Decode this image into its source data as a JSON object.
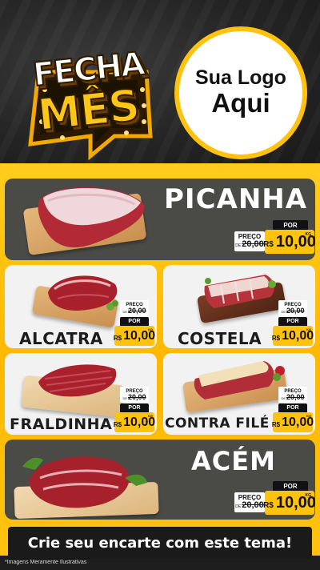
{
  "header": {
    "badge_line_1": "FECHA",
    "badge_line_2": "MÊS",
    "logo_line_1": "Sua Logo",
    "logo_line_2": "Aqui"
  },
  "price_tag": {
    "preco_label": "PREÇO",
    "old_prefix": "DE",
    "por_label": "POR",
    "currency": "R$",
    "unit": "KG"
  },
  "products": [
    {
      "name": "PICANHA",
      "old_price": "20,00",
      "new_price": "10,00"
    },
    {
      "name": "ALCATRA",
      "old_price": "20,00",
      "new_price": "10,00"
    },
    {
      "name": "COSTELA",
      "old_price": "20,00",
      "new_price": "10,00"
    },
    {
      "name": "FRALDINHA",
      "old_price": "20,00",
      "new_price": "10,00"
    },
    {
      "name": "CONTRA FILÉ",
      "old_price": "20,00",
      "new_price": "10,00"
    },
    {
      "name": "ACÉM",
      "old_price": "20,00",
      "new_price": "10,00"
    }
  ],
  "cta": {
    "text": "Crie seu encarte com este tema!"
  },
  "footnote": "*Imagens Meramente Ilustrativas",
  "colors": {
    "accent": "#ffc20e",
    "dark_card": "#4a4a46",
    "background": "#1e1e1e"
  }
}
